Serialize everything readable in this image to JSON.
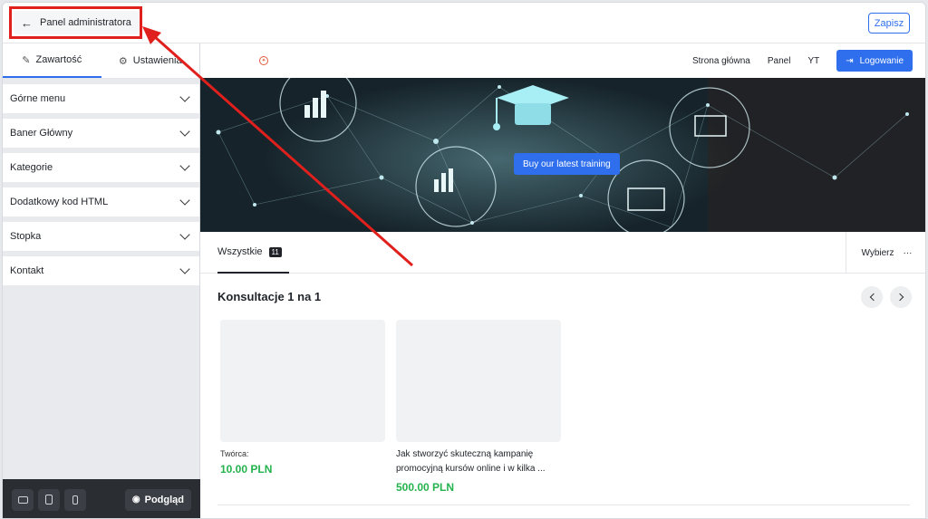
{
  "header": {
    "back_label": "Panel administratora",
    "save_label": "Zapisz"
  },
  "sidebar": {
    "tabs": [
      {
        "label": "Zawartość",
        "active": true
      },
      {
        "label": "Ustawienia",
        "active": false
      }
    ],
    "items": [
      {
        "label": "Górne menu"
      },
      {
        "label": "Baner Główny"
      },
      {
        "label": "Kategorie"
      },
      {
        "label": "Dodatkowy kod HTML"
      },
      {
        "label": "Stopka"
      },
      {
        "label": "Kontakt"
      }
    ],
    "preview_label": "Podgląd"
  },
  "site": {
    "nav": {
      "links": [
        "Strona główna",
        "Panel",
        "YT"
      ],
      "login_label": "Logowanie"
    },
    "hero": {
      "cta_label": "Buy our latest training"
    },
    "filter": {
      "tab_label": "Wszystkie",
      "count": "11",
      "choose_label": "Wybierz"
    },
    "section": {
      "title": "Konsultacje 1 na 1",
      "cards": [
        {
          "meta": "Twórca:",
          "title": "",
          "price": "10.00 PLN"
        },
        {
          "meta": "",
          "title": "Jak stworzyć skuteczną kampanię promocyjną kursów online i w kilka ...",
          "price": "500.00 PLN"
        }
      ]
    }
  },
  "colors": {
    "accent": "#2f6fed",
    "price": "#24b24d",
    "annotation": "#e0201c"
  }
}
